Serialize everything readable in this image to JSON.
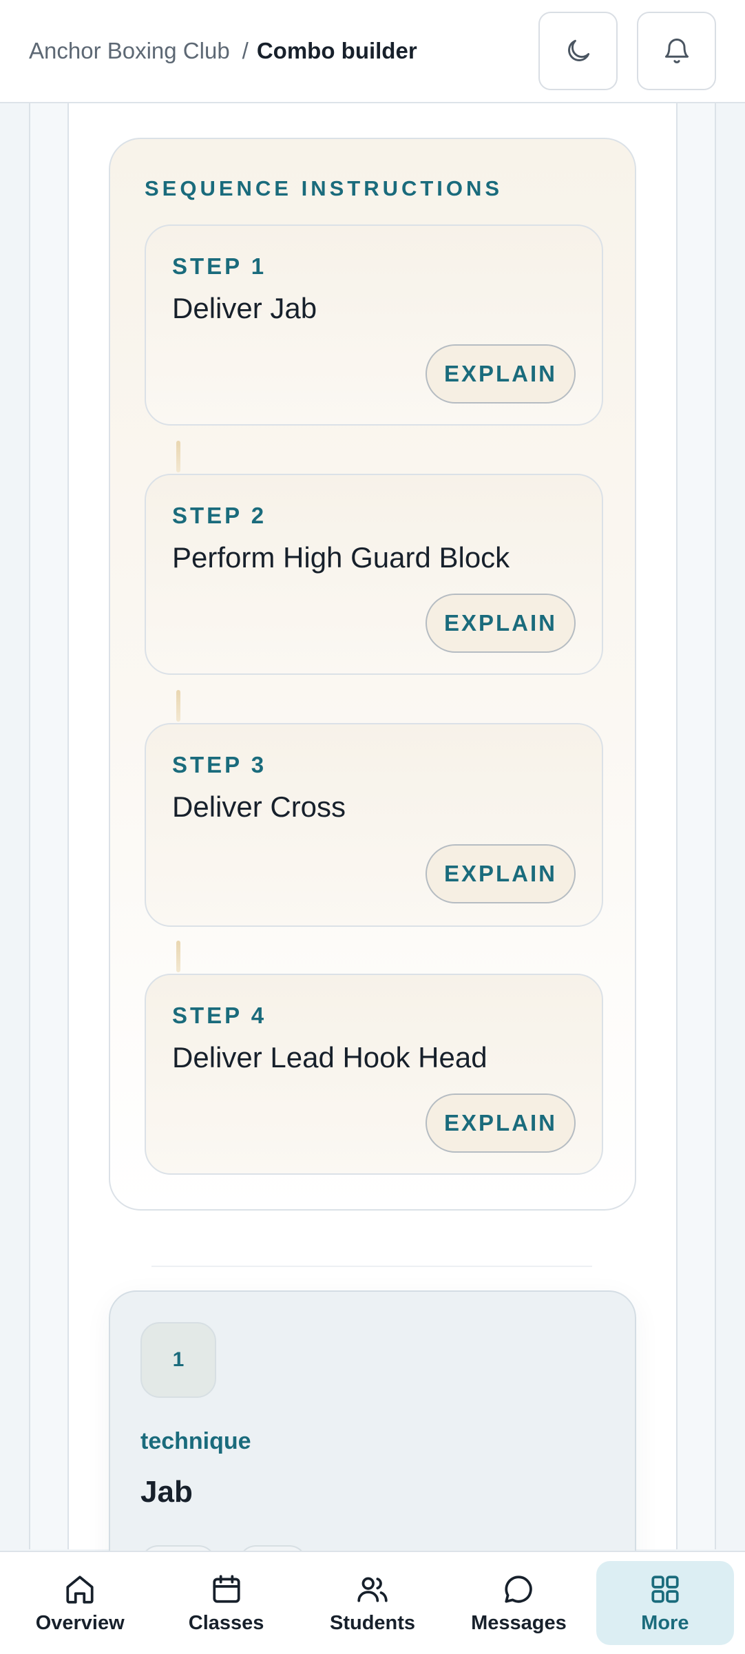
{
  "header": {
    "breadcrumb_parent": "Anchor Boxing Club",
    "breadcrumb_separator": "/",
    "breadcrumb_current": "Combo builder",
    "theme_toggle_icon": "moon-icon",
    "notifications_icon": "bell-icon"
  },
  "sequence": {
    "title": "SEQUENCE INSTRUCTIONS",
    "steps": [
      {
        "label": "STEP 1",
        "name": "Deliver Jab",
        "action": "EXPLAIN"
      },
      {
        "label": "STEP 2",
        "name": "Perform High Guard Block",
        "action": "EXPLAIN"
      },
      {
        "label": "STEP 3",
        "name": "Deliver Cross",
        "action": "EXPLAIN"
      },
      {
        "label": "STEP 4",
        "name": "Deliver Lead Hook Head",
        "action": "EXPLAIN"
      }
    ]
  },
  "technique_card": {
    "number": "1",
    "kind": "technique",
    "name": "Jab"
  },
  "bottom_nav": {
    "items": [
      {
        "label": "Overview",
        "icon": "home-icon"
      },
      {
        "label": "Classes",
        "icon": "calendar-icon"
      },
      {
        "label": "Students",
        "icon": "users-icon"
      },
      {
        "label": "Messages",
        "icon": "chat-icon"
      },
      {
        "label": "More",
        "icon": "grid-icon",
        "active": true
      }
    ]
  },
  "colors": {
    "accent": "#1a6b7c",
    "text": "#17202b",
    "active_nav_bg": "#dceef3"
  }
}
